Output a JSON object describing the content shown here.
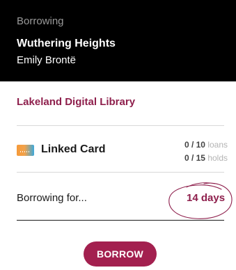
{
  "header": {
    "label": "Borrowing",
    "book_title": "Wuthering Heights",
    "book_author": "Emily Brontë"
  },
  "library": {
    "name": "Lakeland Digital Library"
  },
  "card": {
    "icon": "library-card-icon",
    "label": "Linked Card",
    "loans": {
      "value": "0 / 10",
      "unit": "loans"
    },
    "holds": {
      "value": "0 / 15",
      "unit": "holds"
    }
  },
  "borrow_period": {
    "label": "Borrowing for...",
    "value": "14 days"
  },
  "actions": {
    "borrow_label": "BORROW"
  },
  "colors": {
    "header_bg": "#000000",
    "accent": "#8e1f4c",
    "button_bg": "#a3204f"
  }
}
